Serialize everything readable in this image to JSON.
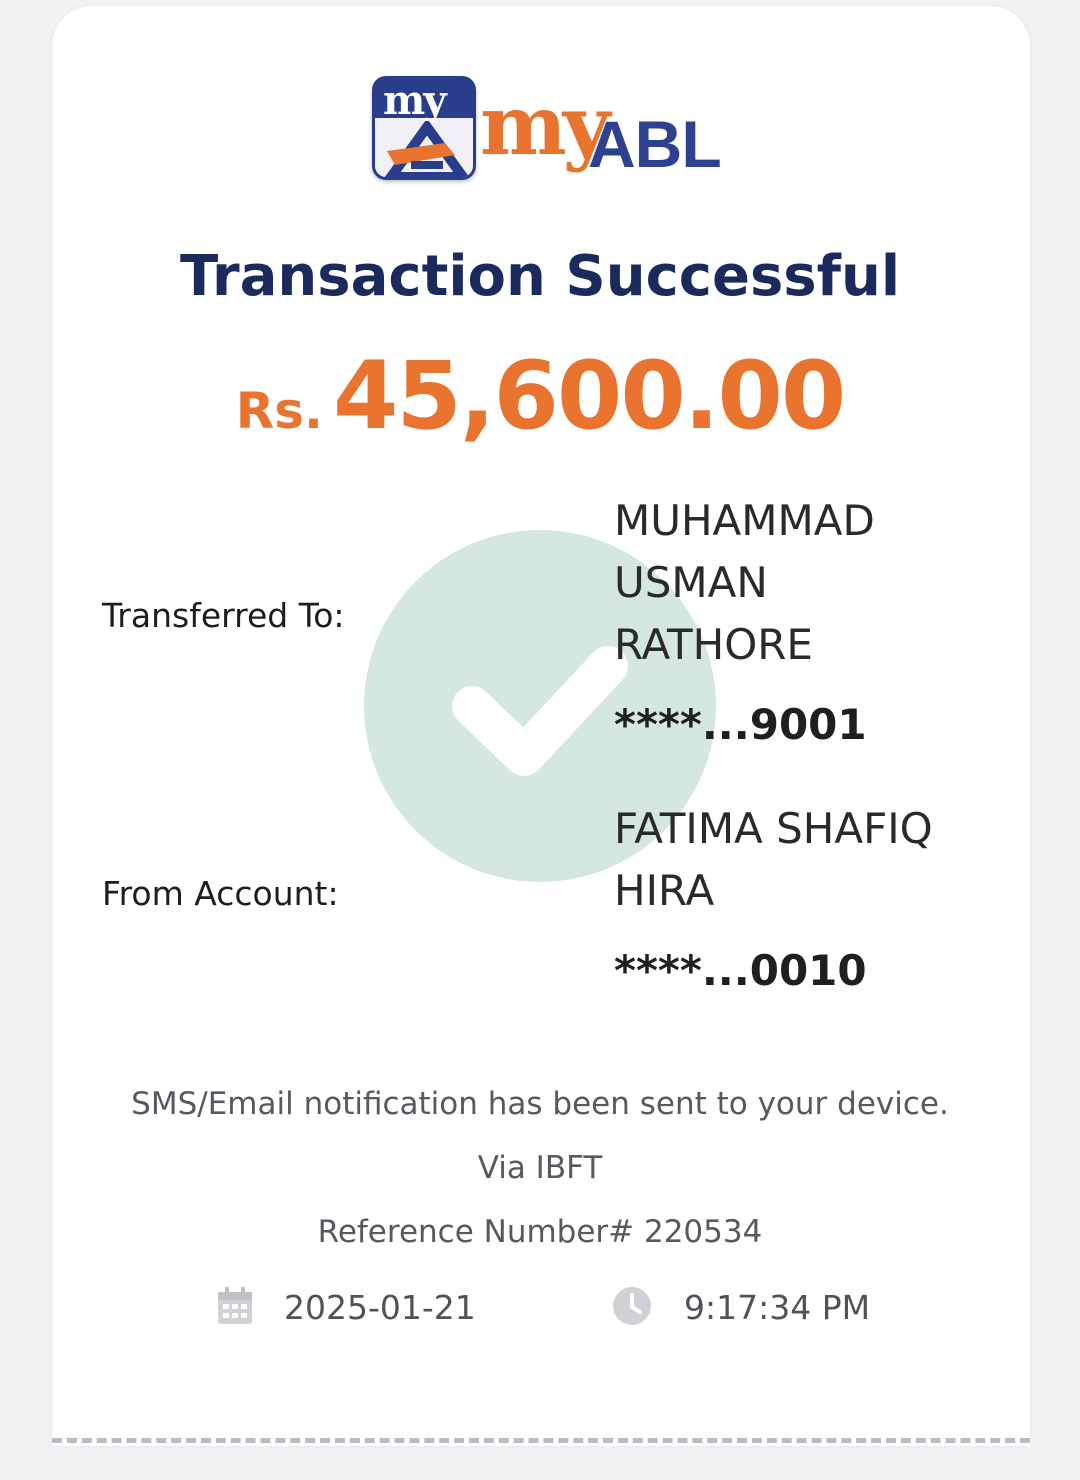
{
  "app": {
    "logo_badge_text": "my",
    "logo_text_my": "my",
    "logo_text_abl": "ABL",
    "brand_color": "#e8742f",
    "brand_navy": "#2e4191"
  },
  "receipt": {
    "title": "Transaction Successful",
    "currency": "Rs.",
    "amount": "45,600.00",
    "status_icon": "check-circle-icon",
    "transferred_to": {
      "label": "Transferred To:",
      "name_lines": [
        "MUHAMMAD",
        "USMAN",
        "RATHORE"
      ],
      "account": "****...9001"
    },
    "from_account": {
      "label": "From Account:",
      "name_lines": [
        "FATIMA SHAFIQ",
        "HIRA"
      ],
      "account": "****...0010"
    },
    "notification": "SMS/Email notification has been sent to your device.",
    "channel": "Via IBFT",
    "reference": "Reference Number# 220534",
    "date": "2025-01-21",
    "time": "9:17:34 PM",
    "date_icon": "calendar-icon",
    "time_icon": "clock-icon"
  }
}
